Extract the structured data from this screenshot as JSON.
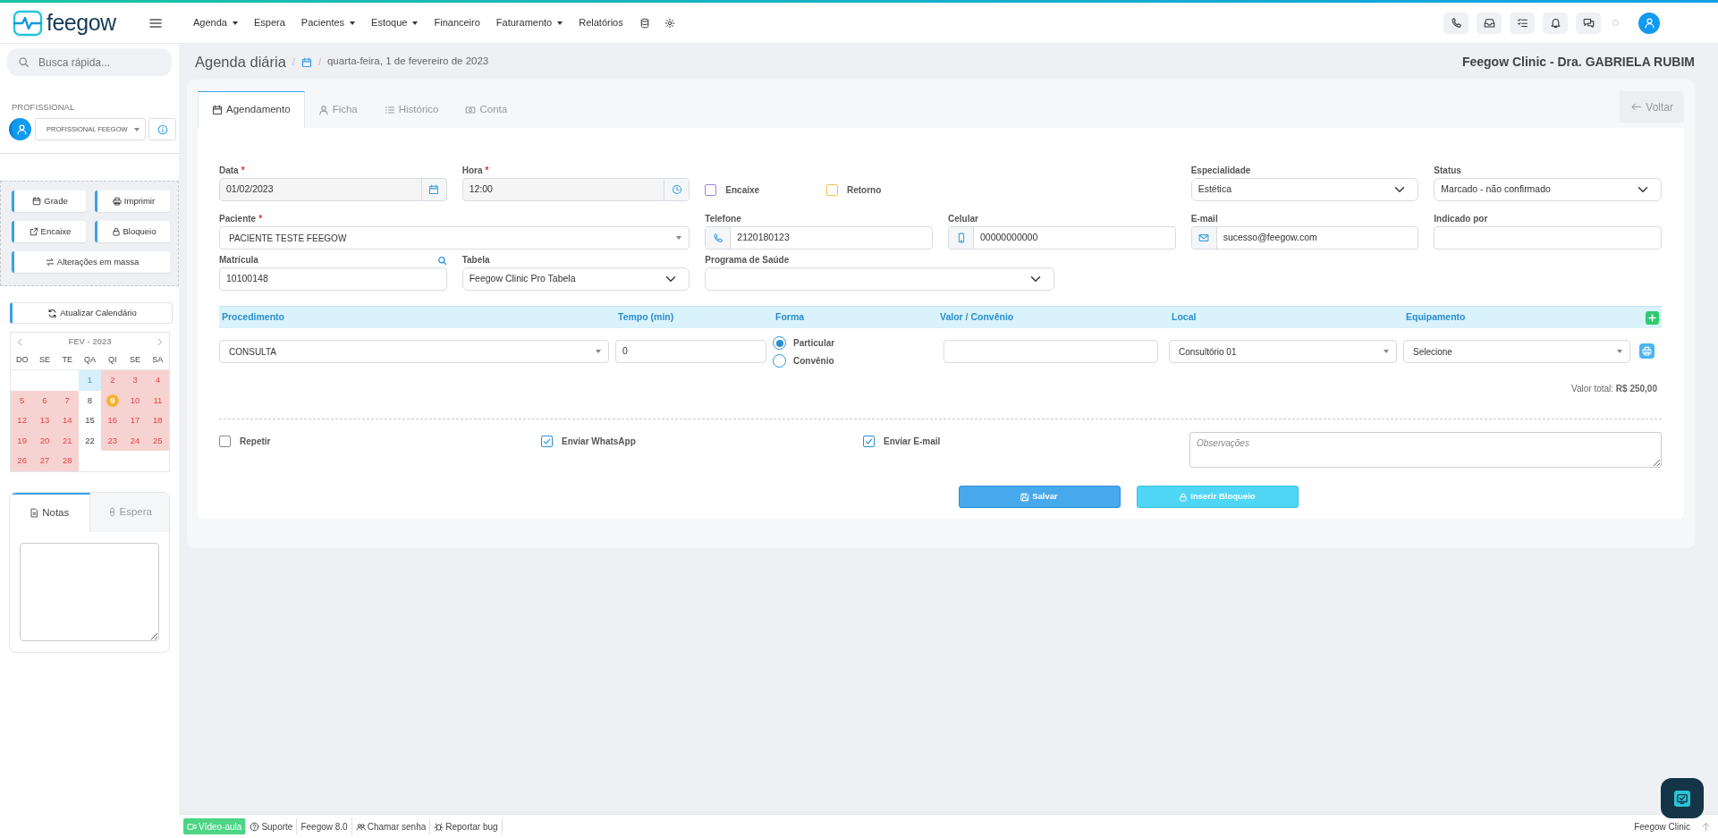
{
  "header": {
    "logo": "feegow",
    "menu": [
      {
        "label": "Agenda",
        "dropdown": true
      },
      {
        "label": "Espera",
        "dropdown": false
      },
      {
        "label": "Pacientes",
        "dropdown": true
      },
      {
        "label": "Estoque",
        "dropdown": true
      },
      {
        "label": "Financeiro",
        "dropdown": false
      },
      {
        "label": "Faturamento",
        "dropdown": true
      },
      {
        "label": "Relatórios",
        "dropdown": false
      }
    ]
  },
  "sidebar": {
    "search": {
      "placeholder": "Busca rápida..."
    },
    "profissional_label": "PROFISSIONAL",
    "profissional": "PROFISSIONAL FEEGOW",
    "actions": [
      {
        "label": "Grade"
      },
      {
        "label": "Imprimir"
      },
      {
        "label": "Encaixe"
      },
      {
        "label": "Bloqueio"
      },
      {
        "label": "Alterações em massa"
      }
    ],
    "refresh_button": "Atualizar Calendário",
    "calendar": {
      "title": "FEV - 2023",
      "weekdays": [
        "DO",
        "SE",
        "TE",
        "QA",
        "QI",
        "SE",
        "SA"
      ],
      "weeks": [
        [
          {
            "kind": "blank"
          },
          {
            "kind": "blank"
          },
          {
            "kind": "blank"
          },
          {
            "day": "1",
            "kind": "selected"
          },
          {
            "day": "2",
            "kind": "blocked"
          },
          {
            "day": "3",
            "kind": "blocked"
          },
          {
            "day": "4",
            "kind": "blocked"
          }
        ],
        [
          {
            "day": "5",
            "kind": "blocked"
          },
          {
            "day": "6",
            "kind": "blocked"
          },
          {
            "day": "7",
            "kind": "blocked"
          },
          {
            "day": "8",
            "kind": "open"
          },
          {
            "day": "9",
            "kind": "today"
          },
          {
            "day": "10",
            "kind": "blocked"
          },
          {
            "day": "11",
            "kind": "blocked"
          }
        ],
        [
          {
            "day": "12",
            "kind": "blocked"
          },
          {
            "day": "13",
            "kind": "blocked"
          },
          {
            "day": "14",
            "kind": "blocked"
          },
          {
            "day": "15",
            "kind": "open"
          },
          {
            "day": "16",
            "kind": "blocked"
          },
          {
            "day": "17",
            "kind": "blocked"
          },
          {
            "day": "18",
            "kind": "blocked"
          }
        ],
        [
          {
            "day": "19",
            "kind": "blocked"
          },
          {
            "day": "20",
            "kind": "blocked"
          },
          {
            "day": "21",
            "kind": "blocked"
          },
          {
            "day": "22",
            "kind": "open"
          },
          {
            "day": "23",
            "kind": "blocked"
          },
          {
            "day": "24",
            "kind": "blocked"
          },
          {
            "day": "25",
            "kind": "blocked"
          }
        ],
        [
          {
            "day": "26",
            "kind": "blocked"
          },
          {
            "day": "27",
            "kind": "blocked"
          },
          {
            "day": "28",
            "kind": "blocked"
          }
        ]
      ]
    },
    "notes_tabs": [
      {
        "label": "Notas",
        "selected": true
      },
      {
        "label": "Espera",
        "selected": false
      }
    ]
  },
  "page": {
    "title": "Agenda diária",
    "separators": [
      "/",
      "/"
    ],
    "date": "quarta-feira, 1 de fevereiro de 2023",
    "clinic": "Feegow Clinic - Dra. GABRIELA RUBIM"
  },
  "tabs": [
    {
      "label": "Agendamento",
      "selected": true
    },
    {
      "label": "Ficha",
      "selected": false
    },
    {
      "label": "Histórico",
      "selected": false
    },
    {
      "label": "Conta",
      "selected": false
    }
  ],
  "back_button": "Voltar",
  "form": {
    "data": {
      "label": "Data",
      "mark": "*",
      "value": "01/02/2023"
    },
    "hora": {
      "label": "Hora",
      "mark": "*",
      "value": "12:00"
    },
    "encaixe": {
      "label": "Encaixe",
      "checked": false,
      "color": "#9c86e0"
    },
    "retorno": {
      "label": "Retorno",
      "checked": false,
      "color": "#f5bd4f"
    },
    "especialidade": {
      "label": "Especialidade",
      "value": "Estética"
    },
    "status": {
      "label": "Status",
      "value": "Marcado - não confirmado"
    },
    "paciente": {
      "label": "Paciente",
      "mark": "*",
      "value": "PACIENTE TESTE FEEGOW"
    },
    "telefone": {
      "label": "Telefone",
      "value": "2120180123"
    },
    "celular": {
      "label": "Celular",
      "value": "00000000000"
    },
    "email": {
      "label": "E-mail",
      "value": "sucesso@feegow.com"
    },
    "indicado_por": {
      "label": "Indicado por"
    },
    "matricula": {
      "label": "Matrícula",
      "value": "10100148"
    },
    "tabela": {
      "label": "Tabela",
      "value": "Feegow Clinic Pro Tabela"
    },
    "programa_saude": {
      "label": "Programa de Saúde"
    }
  },
  "procedures": {
    "columns": [
      "Procedimento",
      "Tempo (min)",
      "Forma",
      "Valor / Convênio",
      "Local",
      "Equipamento"
    ],
    "rows": [
      {
        "procedimento": "CONSULTA",
        "tempo": "0",
        "forma": [
          {
            "label": "Particular",
            "selected": true
          },
          {
            "label": "Convênio",
            "selected": false
          }
        ],
        "local": "Consultório 01",
        "equipamento": "Selecione"
      }
    ],
    "total_label": "Valor total:",
    "total_value": "R$ 250,00"
  },
  "options": [
    {
      "label": "Repetir",
      "checked": false
    },
    {
      "label": "Enviar WhatsApp",
      "checked": true
    },
    {
      "label": "Enviar E-mail",
      "checked": true
    }
  ],
  "observacoes": {
    "placeholder": "Observações"
  },
  "buttons": [
    {
      "label": "Salvar",
      "kind": "primary"
    },
    {
      "label": "Inserir Bloqueio",
      "kind": "info"
    }
  ],
  "status_bar": {
    "items": [
      {
        "label": "Vídeo-aula",
        "kind": "highlight"
      },
      {
        "label": "Suporte",
        "kind": "plain"
      },
      {
        "label": "Feegow 8.0",
        "kind": "text"
      },
      {
        "label": "Chamar senha",
        "kind": "plain"
      },
      {
        "label": "Reportar bug",
        "kind": "plain"
      }
    ],
    "right": "Feegow Clinic"
  }
}
